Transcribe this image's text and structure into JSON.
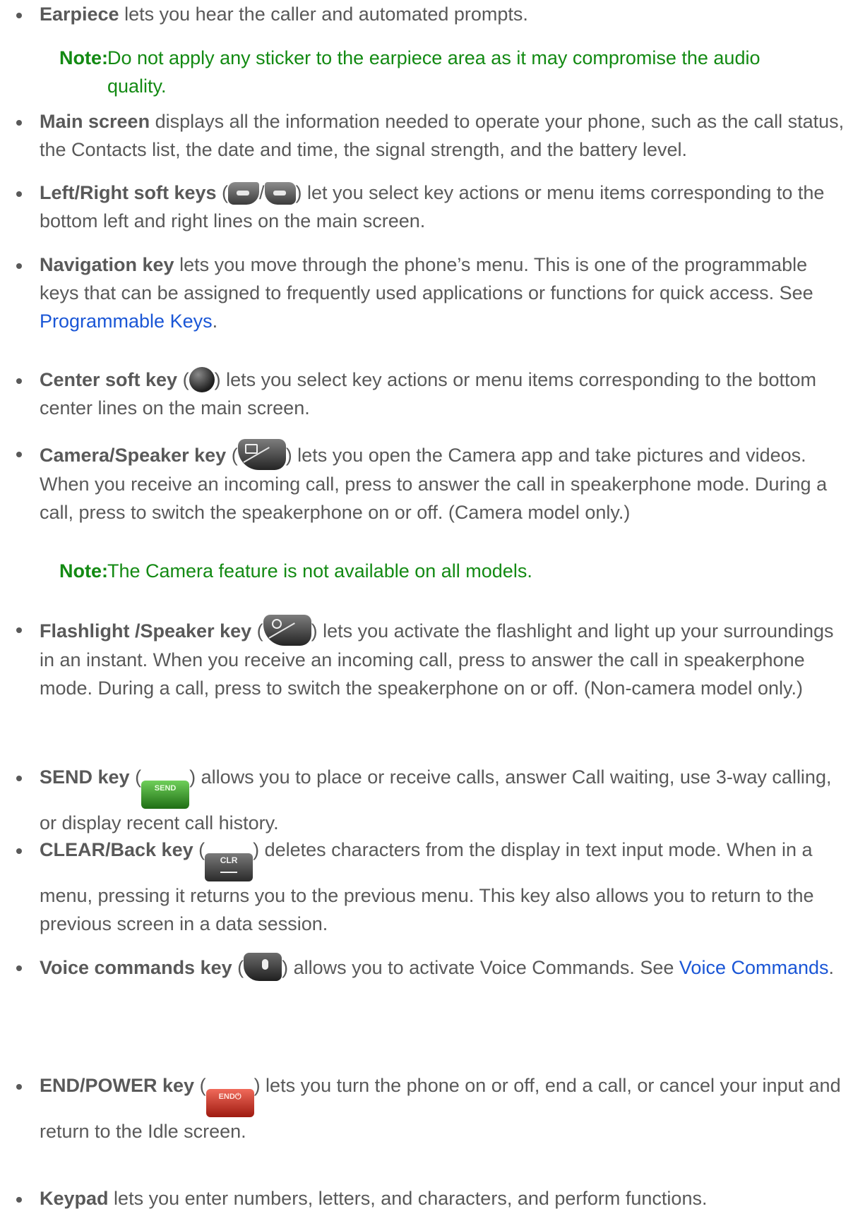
{
  "items": [
    {
      "term": "Earpiece",
      "text": " lets you hear the caller and automated prompts."
    },
    {
      "term": "Main screen",
      "text": " displays all the information needed to operate your phone, such as the call status, the Contacts list, the date and time, the signal strength, and the battery level."
    },
    {
      "term": "Left/Right soft keys",
      "open": " (",
      "sep": "/",
      "text": ") let you select key actions or menu items corresponding to the bottom left and right lines on the main screen."
    },
    {
      "term": "Navigation key",
      "text": " lets you move through the phone’s menu. This is one of the programmable keys that can be assigned to frequently used applications or functions for quick access. See ",
      "link": "Programmable Keys",
      "after": "."
    },
    {
      "term": "Center soft key",
      "open": " (",
      "text": ") lets you select key actions or menu items corresponding to the bottom center lines on the main screen."
    },
    {
      "term": "Camera/Speaker key",
      "open": " (",
      "text": ") lets you open the Camera app and take pictures and videos. When you receive an incoming call, press to answer the call in speakerphone mode. During a call, press to switch the speakerphone on or off. (Camera model only.)"
    },
    {
      "term": "Flashlight /Speaker key",
      "open": " (",
      "text": ") lets you activate the flashlight and light up your surroundings in an instant. When you receive an incoming call, press to answer the call in speakerphone mode. During a call, press to switch the speakerphone on or off. (Non-camera model only.)"
    },
    {
      "term": "SEND key",
      "open": " (",
      "icon_label": "SEND",
      "text": ") allows you to place or receive calls, answer Call waiting, use 3-way calling, or display recent call history."
    },
    {
      "term": "CLEAR/Back key",
      "open": " (",
      "icon_label": "CLR",
      "text": ") deletes characters from the display in text input mode. When in a menu, pressing it returns you to the previous menu. This key also allows you to return to the previous screen in a data session."
    },
    {
      "term": "Voice commands key",
      "open": " (",
      "text": ") allows you to activate Voice Commands. See ",
      "link": "Voice Commands",
      "after": "."
    },
    {
      "term": "END/POWER key",
      "open": " (",
      "icon_label": "END⏻",
      "text": ") lets you turn the phone on or off, end a call, or cancel your input and return to the Idle screen."
    },
    {
      "term": "Keypad",
      "text": " lets you enter numbers, letters, and characters, and perform functions."
    }
  ],
  "notes": [
    {
      "label": "Note:",
      "text": "Do not apply any sticker to the earpiece area as it may compromise the audio",
      "cont": "quality."
    },
    {
      "label": "Note:",
      "text": "The Camera feature is not available on all models."
    }
  ]
}
